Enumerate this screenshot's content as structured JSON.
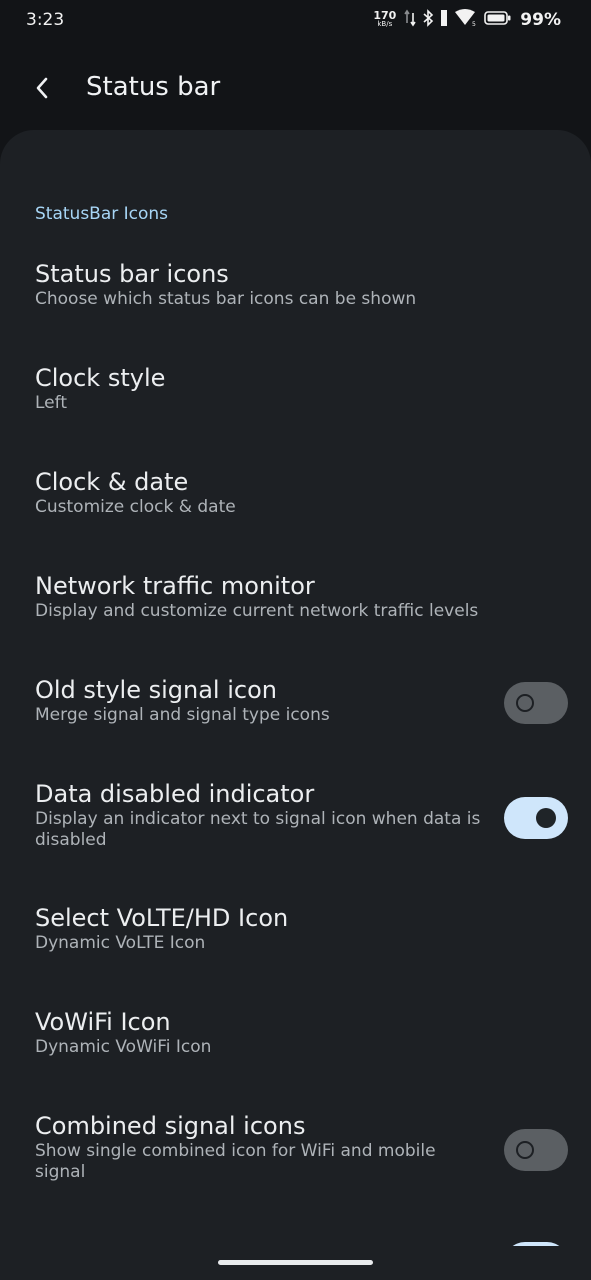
{
  "status_bar": {
    "time": "3:23",
    "net_speed": "170",
    "net_unit": "kB/s",
    "battery_pct": "99%",
    "icons": [
      "data-arrows-icon",
      "bluetooth-icon",
      "signal-icon",
      "wifi-icon",
      "battery-icon"
    ]
  },
  "app_bar": {
    "back_icon": "back-arrow-icon",
    "title": "Status bar"
  },
  "section": {
    "header": "StatusBar Icons"
  },
  "items": [
    {
      "title": "Status bar icons",
      "summary": "Choose which status bar icons can be shown"
    },
    {
      "title": "Clock style",
      "summary": "Left"
    },
    {
      "title": "Clock & date",
      "summary": "Customize clock & date"
    },
    {
      "title": "Network traffic monitor",
      "summary": "Display and customize current network traffic levels"
    },
    {
      "title": "Old style signal icon",
      "summary": "Merge signal and signal type icons",
      "toggle": "off"
    },
    {
      "title": "Data disabled indicator",
      "summary": "Display an indicator next to signal icon when data is disabled",
      "toggle": "on"
    },
    {
      "title": "Select VoLTE/HD Icon",
      "summary": "Dynamic VoLTE Icon"
    },
    {
      "title": "VoWiFi Icon",
      "summary": "Dynamic VoWiFi Icon"
    },
    {
      "title": "Combined signal icons",
      "summary": "Show single combined icon for WiFi and mobile signal",
      "toggle": "off"
    }
  ],
  "colors": {
    "background": "#121417",
    "card": "#1d2024",
    "accent": "#a7d5f5",
    "toggle_on": "#cfe6fb",
    "toggle_off": "#5b5f63"
  }
}
